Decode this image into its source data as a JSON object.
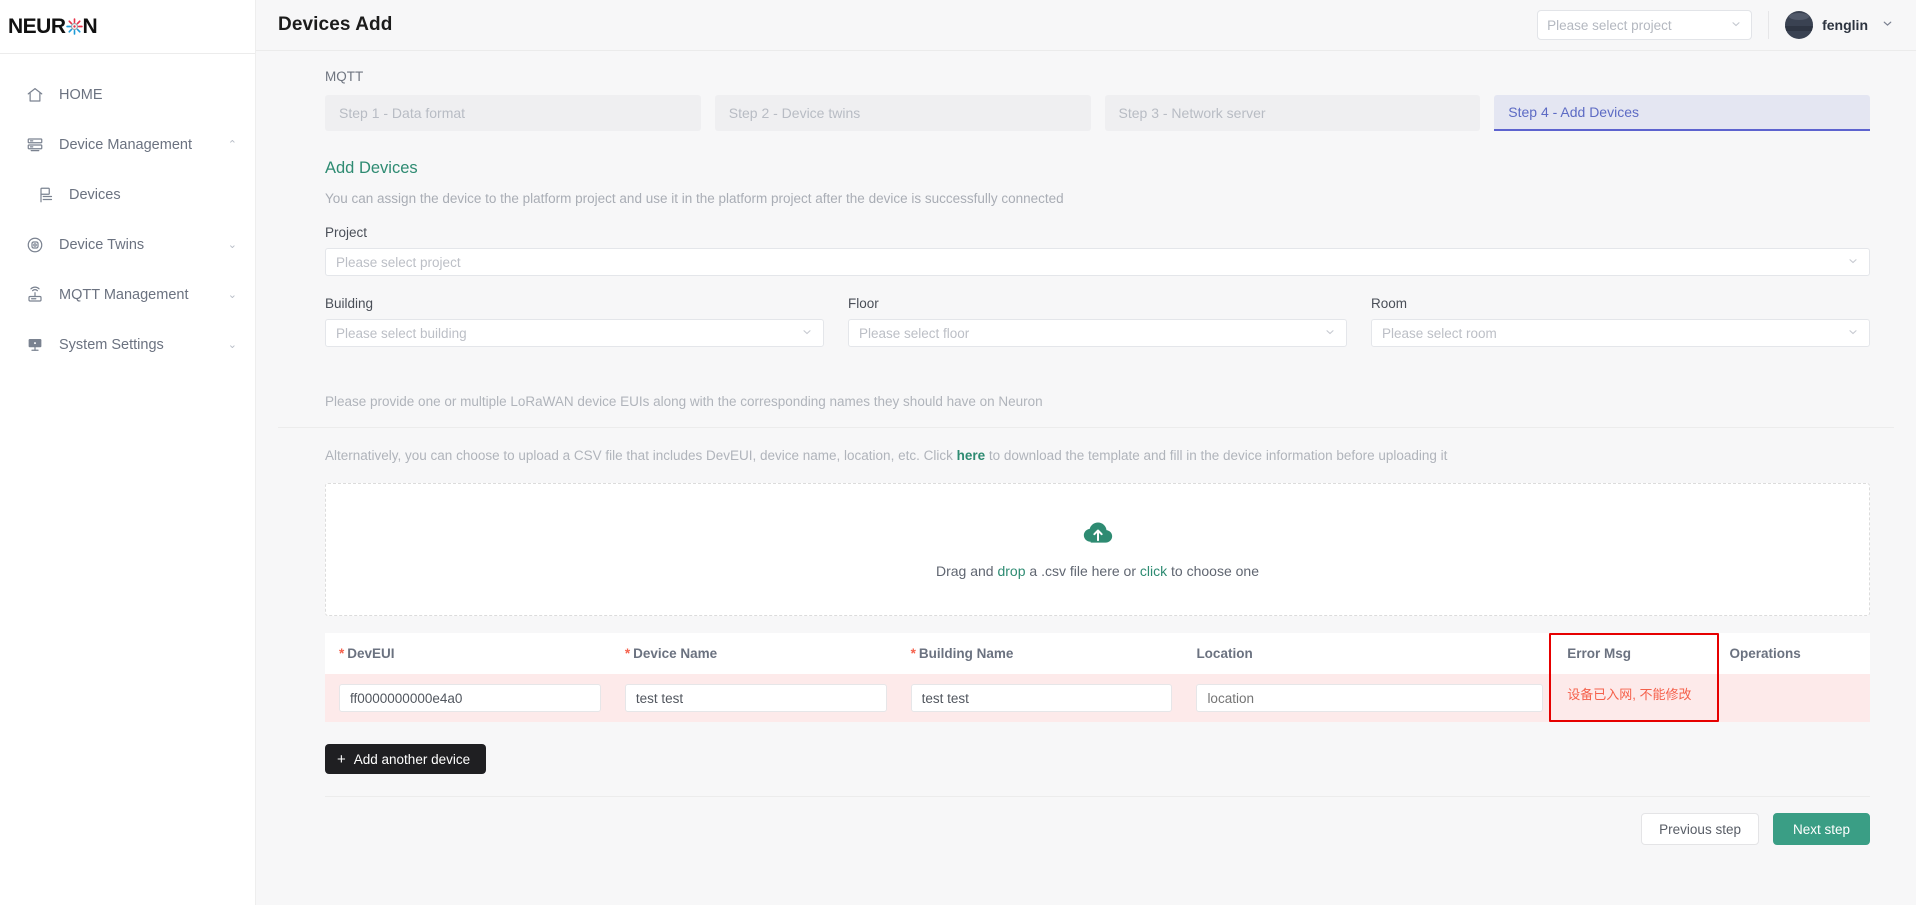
{
  "brand": {
    "name_part1": "NEUR",
    "name_part2": "N",
    "icon": "neuron-spark-icon"
  },
  "sidebar": {
    "items": [
      {
        "label": "HOME",
        "icon": "home-icon",
        "caret": "",
        "sub": false
      },
      {
        "label": "Device Management",
        "icon": "server-icon",
        "caret": "⌃",
        "sub": false
      },
      {
        "label": "Devices",
        "icon": "devices-icon",
        "caret": "",
        "sub": true
      },
      {
        "label": "Device Twins",
        "icon": "twins-icon",
        "caret": "⌄",
        "sub": false
      },
      {
        "label": "MQTT Management",
        "icon": "router-icon",
        "caret": "⌄",
        "sub": false
      },
      {
        "label": "System Settings",
        "icon": "monitor-icon",
        "caret": "⌄",
        "sub": false
      }
    ]
  },
  "topbar": {
    "title": "Devices Add",
    "project_select_placeholder": "Please select project",
    "project_select_value": "",
    "user_name": "fenglin",
    "chevron": "⌄"
  },
  "breadcrumb": "MQTT",
  "steps": [
    {
      "label": "Step 1 - Data format",
      "active": false
    },
    {
      "label": "Step 2 - Device twins",
      "active": false
    },
    {
      "label": "Step 3 - Network server",
      "active": false
    },
    {
      "label": "Step 4 - Add Devices",
      "active": true
    }
  ],
  "section": {
    "title": "Add Devices",
    "description": "You can assign the device to the platform project and use it in the platform project after the device is successfully connected"
  },
  "fields": {
    "project_label": "Project",
    "project_placeholder": "Please select project",
    "building_label": "Building",
    "building_placeholder": "Please select building",
    "floor_label": "Floor",
    "floor_placeholder": "Please select floor",
    "room_label": "Room",
    "room_placeholder": "Please select room"
  },
  "hints": {
    "line1": "Please provide one or multiple LoRaWAN device EUIs along with the corresponding names they should have on Neuron",
    "line2_before": "Alternatively, you can choose to upload a CSV file that includes DevEUI, device name, location, etc. Click",
    "line2_link": "here",
    "line2_after": "to download the template and fill in the device information before uploading it"
  },
  "dropzone": {
    "icon": "cloud-upload-icon",
    "text_before": "Drag and ",
    "text_green1": "drop",
    "text_mid": " a .csv file here or ",
    "text_green2": "click",
    "text_after": " to choose one"
  },
  "table": {
    "columns": [
      {
        "label": "DevEUI",
        "required": true
      },
      {
        "label": "Device Name",
        "required": true
      },
      {
        "label": "Building Name",
        "required": true
      },
      {
        "label": "Location",
        "required": false
      },
      {
        "label": "Error Msg",
        "required": false
      },
      {
        "label": "Operations",
        "required": false
      }
    ],
    "rows": [
      {
        "deveui": "ff0000000000e4a0",
        "device_name": "test test",
        "building_name": "test test",
        "location_placeholder": "location",
        "location": "",
        "error_msg": "设备已入网, 不能修改",
        "operations": ""
      }
    ]
  },
  "buttons": {
    "add_device": "Add another device",
    "add_device_plus": "+",
    "previous_step": "Previous step",
    "next_step": "Next step"
  },
  "colors": {
    "accent_green": "#2e8b72",
    "primary_button": "#3a9e85",
    "active_step_text": "#5d6bc4",
    "active_step_bg": "#e4e6f2",
    "error_red": "#f5614c",
    "error_border": "#e60000",
    "error_row_bg": "#fdeaea"
  }
}
